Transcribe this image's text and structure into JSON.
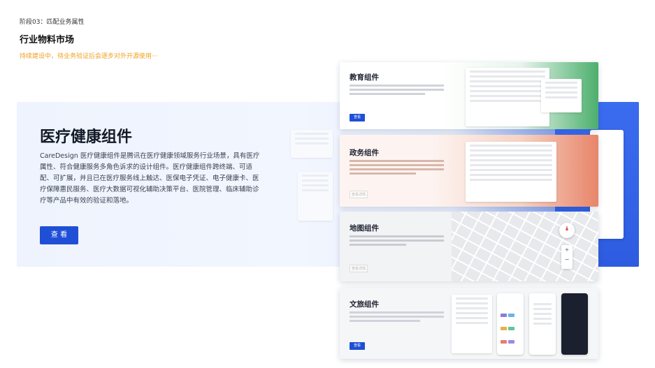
{
  "header": {
    "stage": "阶段03：匹配业务属性",
    "title": "行业物料市场",
    "note": "持续建设中，待业务验证后会逐步对外开源使用···"
  },
  "hero": {
    "title": "医疗健康组件",
    "description": "CareDesign 医疗健康组件是腾讯在医疗健康领域服务行业场景，具有医疗属性、符合健康服务多角色诉求的设计组件。医疗健康组件跨终端、可适配、可扩展，并且已在医疗服务线上触达、医保电子凭证、电子健康卡、医疗保障惠民服务、医疗大数据可视化辅助决策平台、医院管理、临床辅助诊疗等产品中有效的验证和落地。",
    "button": "查 看"
  },
  "cards": [
    {
      "title": "教育组件",
      "button": "查看",
      "accent": "#4caf6d"
    },
    {
      "title": "政务组件",
      "button": "查看详情",
      "accent": "#e8856a"
    },
    {
      "title": "地图组件",
      "button": "查看详情",
      "accent": "#1f4fd6"
    },
    {
      "title": "文旅组件",
      "button": "查看",
      "accent": "#1f4fd6"
    }
  ],
  "map": {
    "zoom_in": "+",
    "zoom_out": "−"
  },
  "colors": {
    "primary": "#1f4fd6",
    "note": "#f0a020"
  }
}
